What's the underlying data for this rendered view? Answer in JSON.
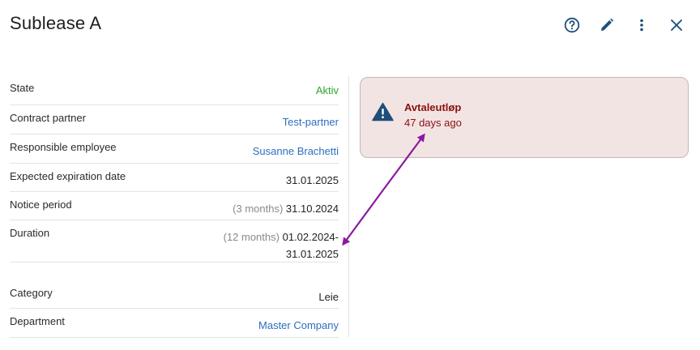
{
  "header": {
    "title": "Sublease A",
    "actions": [
      {
        "name": "help-button",
        "icon": "help-circle-icon"
      },
      {
        "name": "edit-button",
        "icon": "pencil-icon"
      },
      {
        "name": "more-button",
        "icon": "more-vertical-icon"
      },
      {
        "name": "close-button",
        "icon": "close-icon"
      }
    ]
  },
  "details": {
    "state": {
      "label": "State",
      "value": "Aktiv"
    },
    "contract_partner": {
      "label": "Contract partner",
      "value": "Test-partner"
    },
    "responsible_employee": {
      "label": "Responsible employee",
      "value": "Susanne Brachetti"
    },
    "expected_expiration": {
      "label": "Expected expiration date",
      "value": "31.01.2025"
    },
    "notice_period": {
      "label": "Notice period",
      "hint": "(3 months)",
      "value": "31.10.2024"
    },
    "duration": {
      "label": "Duration",
      "hint": "(12 months)",
      "value_line1": "01.02.2024-",
      "value_line2": "31.01.2025"
    },
    "category": {
      "label": "Category",
      "value": "Leie"
    },
    "department": {
      "label": "Department",
      "value": "Master Company"
    }
  },
  "alert": {
    "icon": "warning-triangle-icon",
    "title": "Avtaleutløp",
    "subtitle": "47 days ago"
  },
  "colors": {
    "accent": "#2a6fc0",
    "status_active": "#2ea52e",
    "alert_text": "#8b1010",
    "alert_bg": "#f3e4e4",
    "annotation_arrow": "#8a1aa0",
    "icon_blue": "#1f4e7a"
  }
}
